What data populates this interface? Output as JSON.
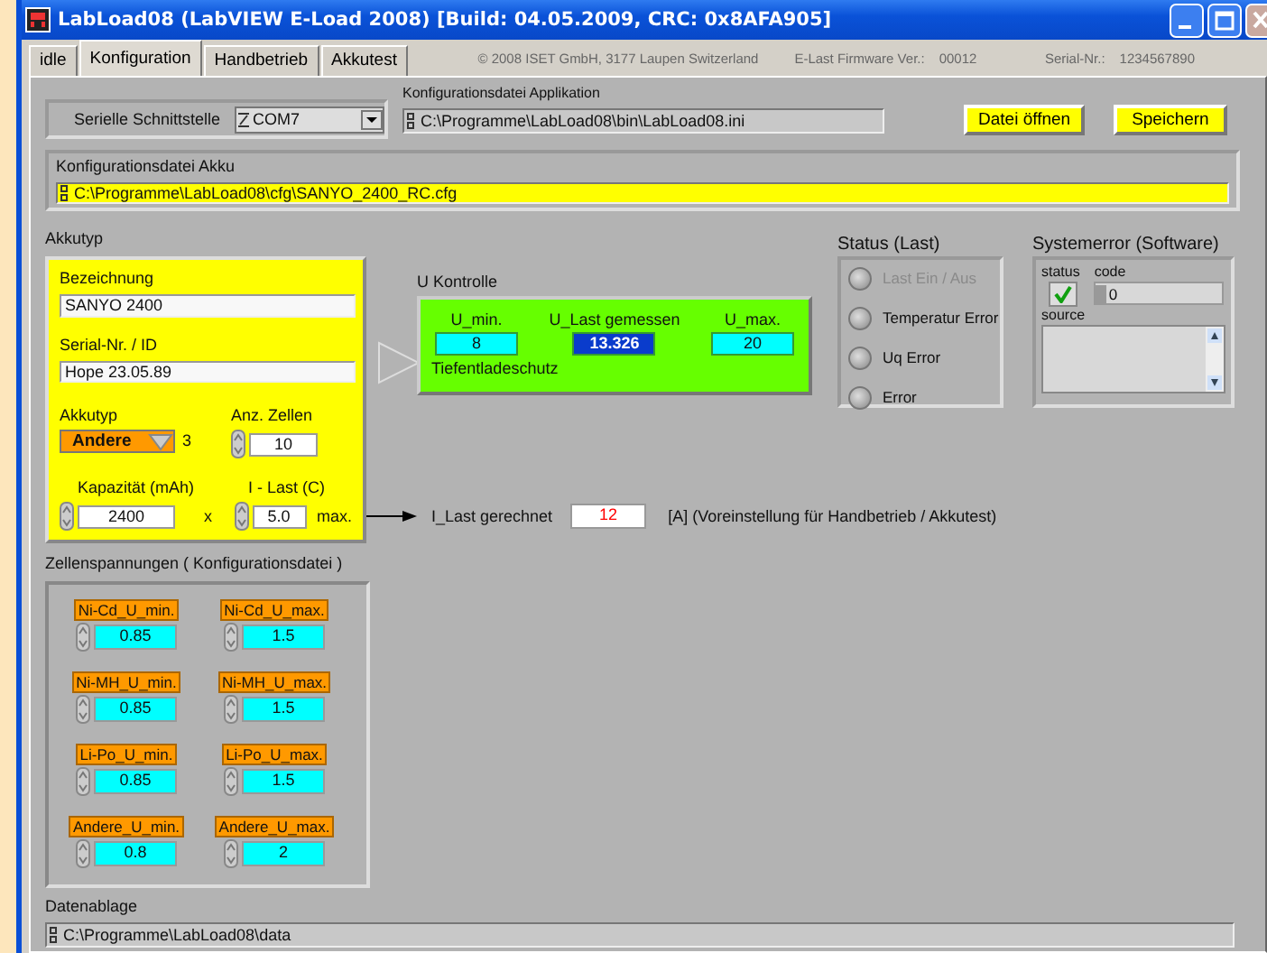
{
  "window": {
    "title": "LabLoad08 (LabVIEW E-Load 2008)  [Build: 04.05.2009, CRC: 0x8AFA905]"
  },
  "tabs": [
    {
      "label": "idle",
      "selected": false
    },
    {
      "label": "Konfiguration",
      "selected": true
    },
    {
      "label": "Handbetrieb",
      "selected": false
    },
    {
      "label": "Akkutest",
      "selected": false
    }
  ],
  "header_info": {
    "copyright": "© 2008 ISET GmbH, 3177 Laupen Switzerland",
    "firmware_label": "E-Last Firmware Ver.:",
    "firmware": "00012",
    "serial_label": "Serial-Nr.:",
    "serial": "1234567890"
  },
  "serial_port": {
    "label": "Serielle Schnittstelle",
    "value": "COM7"
  },
  "app_config": {
    "label": "Konfigurationsdatei Applikation",
    "path": "C:\\Programme\\LabLoad08\\bin\\LabLoad08.ini"
  },
  "buttons": [
    "Datei öffnen",
    "Speichern"
  ],
  "akku_config": {
    "label": "Konfigurationsdatei Akku",
    "path": "C:\\Programme\\LabLoad08\\cfg\\SANYO_2400_RC.cfg"
  },
  "akkutyp": {
    "title": "Akkutyp",
    "name_label": "Bezeichnung",
    "name": "SANYO 2400",
    "serial_label": "Serial-Nr. / ID",
    "serial": "Hope 23.05.89",
    "type_label": "Akkutyp",
    "type": "Andere",
    "type_index": "3",
    "cells_label": "Anz. Zellen",
    "cells": "10",
    "capacity_label": "Kapazität (mAh)",
    "capacity": "2400",
    "times": "x",
    "current_label": "I - Last (C)",
    "current": "5.0",
    "max": "max."
  },
  "u_kontrolle": {
    "title": "U Kontrolle",
    "indicators": [
      {
        "label": "U_min.",
        "value": "8",
        "kind": "limit"
      },
      {
        "label": "U_Last gemessen",
        "value": "13.326",
        "kind": "measured"
      },
      {
        "label": "U_max.",
        "value": "20",
        "kind": "limit"
      }
    ],
    "caption": "Tiefentladeschutz"
  },
  "status": {
    "title": "Status (Last)",
    "leds": [
      {
        "label": "Last Ein / Aus",
        "on": false,
        "disabled": true
      },
      {
        "label": "Temperatur Error",
        "on": false,
        "disabled": false
      },
      {
        "label": "Uq Error",
        "on": false,
        "disabled": false
      },
      {
        "label": "Error",
        "on": false,
        "disabled": false
      }
    ]
  },
  "systemerror": {
    "title": "Systemerror (Software)",
    "status_label": "status",
    "checked": true,
    "code_label": "code",
    "code": "0",
    "source_label": "source"
  },
  "i_last": {
    "label": "I_Last gerechnet",
    "value": "12",
    "note": "[A] (Voreinstellung für Handbetrieb / Akkutest)"
  },
  "zellenspannungen": {
    "title": "Zellenspannungen  ( Konfigurationsdatei )",
    "cells": [
      {
        "label": "Ni-Cd_U_min.",
        "value": "0.85"
      },
      {
        "label": "Ni-Cd_U_max.",
        "value": "1.5"
      },
      {
        "label": "Ni-MH_U_min.",
        "value": "0.85"
      },
      {
        "label": "Ni-MH_U_max.",
        "value": "1.5"
      },
      {
        "label": "Li-Po_U_min.",
        "value": "0.85"
      },
      {
        "label": "Li-Po_U_max.",
        "value": "1.5"
      },
      {
        "label": "Andere_U_min.",
        "value": "0.8"
      },
      {
        "label": "Andere_U_max.",
        "value": "2"
      }
    ]
  },
  "datenablage": {
    "label": "Datenablage",
    "path": "C:\\Programme\\LabLoad08\\data"
  }
}
